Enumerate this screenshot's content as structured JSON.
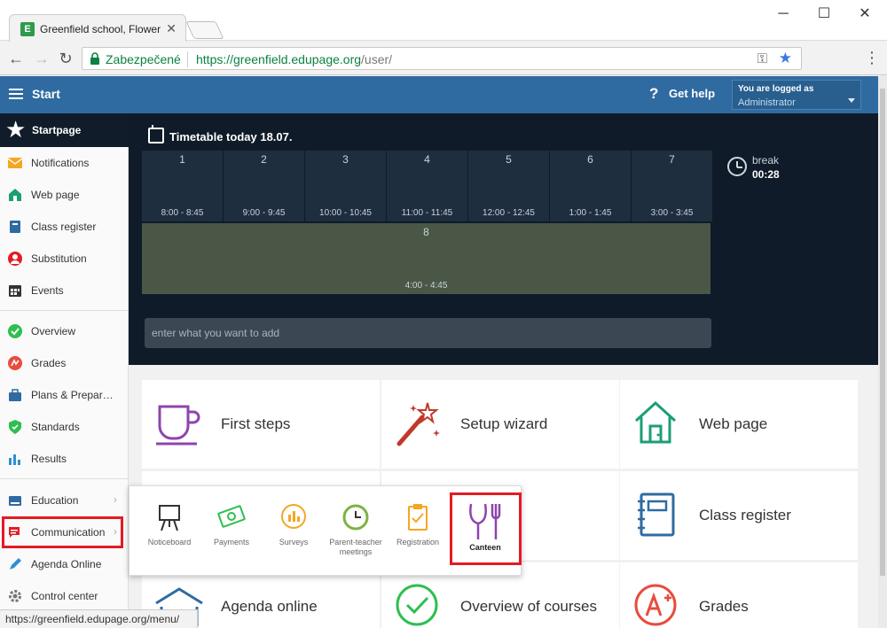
{
  "browser": {
    "tab_title": "Greenfield school, Flower",
    "favicon_letter": "E",
    "secure_label": "Zabezpečené",
    "url_host": "https://greenfield.edupage.org",
    "url_path": "/user/",
    "status_url": "https://greenfield.edupage.org/menu/"
  },
  "header": {
    "start_label": "Start",
    "help_label": "Get help",
    "logged_label": "You are logged as",
    "user": "Administrator"
  },
  "sidebar": {
    "startpage": "Startpage",
    "items": [
      {
        "label": "Notifications",
        "icon": "envelope-icon",
        "color": "#f5a623"
      },
      {
        "label": "Web page",
        "icon": "house-icon",
        "color": "#1b9e77"
      },
      {
        "label": "Class register",
        "icon": "book-icon",
        "color": "#2f6ba1"
      },
      {
        "label": "Substitution",
        "icon": "person-icon",
        "color": "#e31b23"
      },
      {
        "label": "Events",
        "icon": "calendar-icon",
        "color": "#333333"
      },
      {
        "label": "Overview",
        "icon": "check-circle-icon",
        "color": "#2ebf4f"
      },
      {
        "label": "Grades",
        "icon": "grade-icon",
        "color": "#e84c3d"
      },
      {
        "label": "Plans & Prepar…",
        "icon": "briefcase-icon",
        "color": "#2f6ba1"
      },
      {
        "label": "Standards",
        "icon": "shield-icon",
        "color": "#2ebf4f"
      },
      {
        "label": "Results",
        "icon": "bar-chart-icon",
        "color": "#2f8fd0"
      },
      {
        "label": "Education",
        "icon": "education-icon",
        "color": "#2f6ba1"
      },
      {
        "label": "Communication",
        "icon": "chat-icon",
        "color": "#e31b23"
      },
      {
        "label": "Agenda Online",
        "icon": "pen-icon",
        "color": "#2f8fd0"
      },
      {
        "label": "Control center",
        "icon": "gear-icon",
        "color": "#777777"
      }
    ]
  },
  "timetable": {
    "title": "Timetable today 18.07.",
    "periods": [
      {
        "num": "1",
        "time": "8:00 - 8:45"
      },
      {
        "num": "2",
        "time": "9:00 - 9:45"
      },
      {
        "num": "3",
        "time": "10:00 - 10:45"
      },
      {
        "num": "4",
        "time": "11:00 - 11:45"
      },
      {
        "num": "5",
        "time": "12:00 - 12:45"
      },
      {
        "num": "6",
        "time": "1:00 - 1:45"
      },
      {
        "num": "7",
        "time": "3:00 - 3:45"
      },
      {
        "num": "8",
        "time": "4:00 - 4:45"
      }
    ],
    "break_label": "break",
    "break_time": "00:28",
    "add_placeholder": "enter what you want to add"
  },
  "tiles": [
    {
      "label": "First steps",
      "icon": "cup-icon"
    },
    {
      "label": "Setup wizard",
      "icon": "magic-wand-icon"
    },
    {
      "label": "Web page",
      "icon": "house-icon"
    },
    {
      "label": "Class register",
      "icon": "notebook-icon"
    },
    {
      "label": "Agenda online",
      "icon": "book-open-icon"
    },
    {
      "label": "Overview of courses",
      "icon": "check-circle-icon"
    },
    {
      "label": "Grades",
      "icon": "grade-a-plus-icon"
    }
  ],
  "popup": {
    "items": [
      {
        "label": "Noticeboard",
        "icon": "easel-icon"
      },
      {
        "label": "Payments",
        "icon": "money-icon"
      },
      {
        "label": "Surveys",
        "icon": "survey-icon"
      },
      {
        "label": "Parent-teacher meetings",
        "icon": "clock-icon"
      },
      {
        "label": "Registration",
        "icon": "clipboard-icon"
      },
      {
        "label": "Canteen",
        "icon": "fork-knife-icon"
      }
    ]
  },
  "colors": {
    "header_blue": "#2f6ba1",
    "dark_panel": "#0f1b28",
    "highlight_red": "#e31b23",
    "purple_icon": "#8e44ad"
  }
}
